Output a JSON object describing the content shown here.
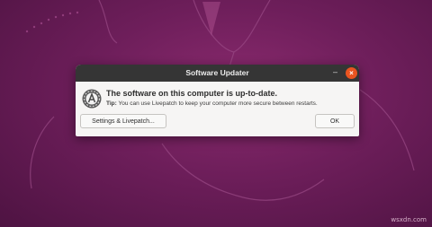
{
  "window": {
    "title": "Software Updater",
    "minimize_symbol": "–",
    "close_symbol": "×"
  },
  "message": {
    "icon": "software-updater-icon",
    "headline": "The software on this computer is up-to-date.",
    "tip_label": "Tip:",
    "tip_text": " You can use Livepatch to keep your computer more secure between restarts."
  },
  "buttons": {
    "settings_label": "Settings & Livepatch...",
    "ok_label": "OK"
  },
  "watermark": "wsxdn.com",
  "colors": {
    "titlebar": "#353535",
    "close_button": "#e95420",
    "wallpaper": "#6d1e5a"
  }
}
